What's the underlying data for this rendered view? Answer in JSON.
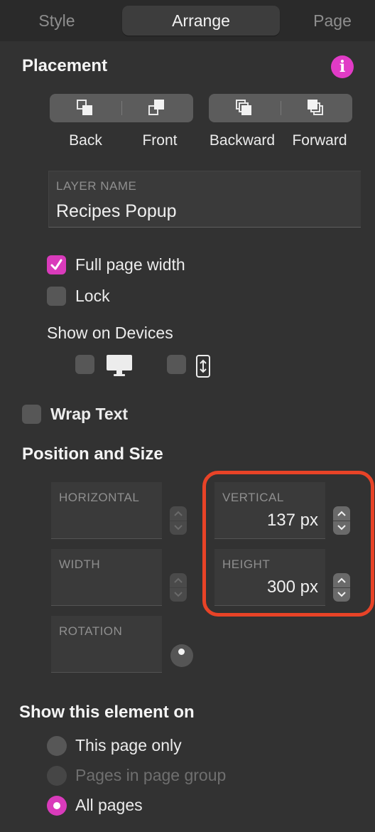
{
  "tabs": [
    {
      "label": "Style"
    },
    {
      "label": "Arrange"
    },
    {
      "label": "Page"
    }
  ],
  "placement": {
    "title": "Placement",
    "buttons": [
      "Back",
      "Front",
      "Backward",
      "Forward"
    ]
  },
  "layer_name": {
    "caption": "LAYER NAME",
    "value": "Recipes Popup"
  },
  "options": {
    "full_page_width": {
      "label": "Full page width",
      "checked": true
    },
    "lock": {
      "label": "Lock",
      "checked": false
    }
  },
  "devices": {
    "title": "Show on Devices",
    "desktop_checked": false,
    "mobile_checked": false
  },
  "wrap_text": {
    "label": "Wrap Text",
    "checked": false
  },
  "position": {
    "title": "Position and Size",
    "horizontal": {
      "caption": "HORIZONTAL",
      "value": ""
    },
    "vertical": {
      "caption": "VERTICAL",
      "value": "137 px"
    },
    "width": {
      "caption": "WIDTH",
      "value": ""
    },
    "height": {
      "caption": "HEIGHT",
      "value": "300 px"
    },
    "rotation": {
      "caption": "ROTATION",
      "value": ""
    }
  },
  "show_on": {
    "title": "Show this element on",
    "options": [
      {
        "label": "This page only",
        "state": "unselected"
      },
      {
        "label": "Pages in page group",
        "state": "disabled"
      },
      {
        "label": "All pages",
        "state": "selected"
      }
    ]
  },
  "colors": {
    "accent": "#d93bbb",
    "highlight": "#e84327",
    "background": "#323232"
  },
  "icons": [
    "info-icon",
    "send-to-back-icon",
    "bring-to-front-icon",
    "send-backward-icon",
    "bring-forward-icon",
    "checkmark-icon",
    "desktop-icon",
    "mobile-icon",
    "rotation-knob-icon"
  ]
}
